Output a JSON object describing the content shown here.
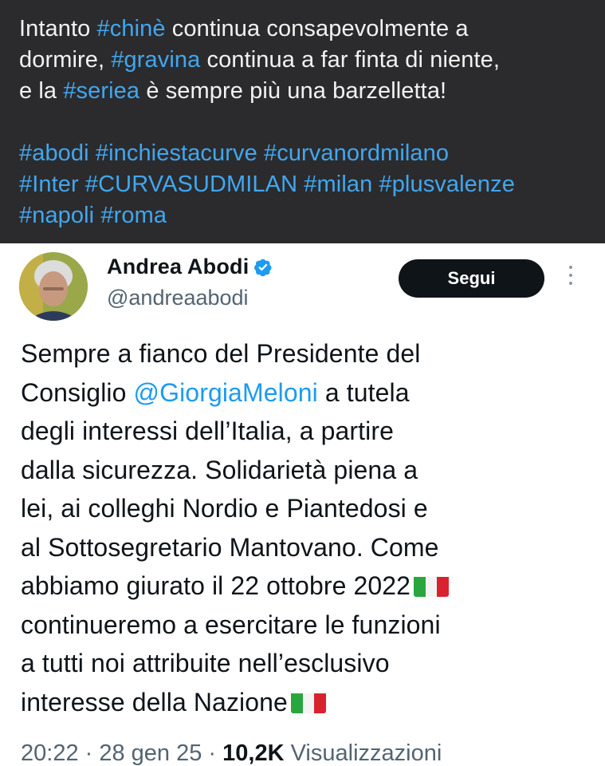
{
  "dark_post": {
    "line1": {
      "pre": "Intanto ",
      "tag": "#chinè",
      "post": " continua consapevolmente a"
    },
    "line2": {
      "pre": "dormire, ",
      "tag": "#gravina",
      "post": " continua a far finta di niente,"
    },
    "line3": {
      "pre": "e la ",
      "tag": "#seriea",
      "post": " è sempre più una barzelletta!"
    },
    "hashtags_line1": "#abodi #inchiestacurve #curvanordmilano",
    "hashtags_line2": "#Inter #CURVASUDMILAN #milan #plusvalenze",
    "hashtags_line3": "#napoli #roma"
  },
  "tweet": {
    "author_name": "Andrea Abodi",
    "author_handle": "@andreaabodi",
    "follow_label": "Segui",
    "body_lines": {
      "l1": "Sempre a fianco del Presidente del",
      "l2_pre": "Consiglio ",
      "l2_mention": "@GiorgiaMeloni",
      "l2_post": " a tutela",
      "l3": "degli interessi dell’Italia, a partire",
      "l4": "dalla sicurezza. Solidarietà piena a",
      "l5": "lei, ai colleghi Nordio e Piantedosi e",
      "l6": "al Sottosegretario Mantovano. Come",
      "l7": "abbiamo giurato il 22 ottobre 2022",
      "l8": "continueremo a esercitare le funzioni",
      "l9": "a tutti noi attribuite nell’esclusivo",
      "l10": "interesse della Nazione"
    },
    "time": "20:22",
    "separator": " · ",
    "date": "28 gen 25",
    "views_count": "10,2K",
    "views_label": " Visualizzazioni",
    "icons": {
      "verified": "verified-badge-icon",
      "more": "more-vertical-icon",
      "flag": "italy-flag-emoji"
    },
    "colors": {
      "link": "#1d9bf0",
      "dark_bg": "#2b2b2d",
      "hashtag_dark": "#41a7f0",
      "button_bg": "#0f1419"
    }
  }
}
